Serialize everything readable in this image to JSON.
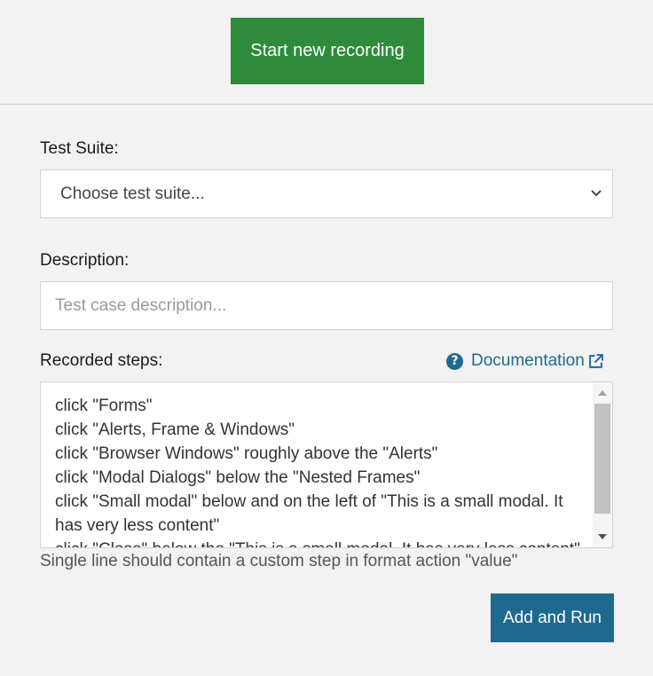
{
  "header": {
    "start_button_label": "Start new recording"
  },
  "form": {
    "test_suite_label": "Test Suite:",
    "test_suite_selected": "Choose test suite...",
    "description_label": "Description:",
    "description_placeholder": "Test case description...",
    "description_value": "",
    "recorded_steps_label": "Recorded steps:",
    "documentation_link": "Documentation",
    "steps": [
      "click \"Forms\"",
      "click \"Alerts, Frame & Windows\"",
      "click \"Browser Windows\" roughly above the \"Alerts\"",
      "click \"Modal Dialogs\" below the \"Nested Frames\"",
      "click \"Small modal\" below and on the left of \"This is a small modal. It",
      "has very less content\"",
      "click \"Close\" below the \"This is a small modal. It has very less content\""
    ],
    "hint": "Single line should contain a custom step in format action \"value\"",
    "add_run_button_label": "Add and Run"
  },
  "colors": {
    "start_button": "#2e8b3a",
    "primary": "#1e6a8f",
    "background": "#f2f2f2"
  },
  "icons": {
    "help": "question-circle-icon",
    "external": "external-link-icon",
    "dropdown": "chevron-down-icon"
  }
}
